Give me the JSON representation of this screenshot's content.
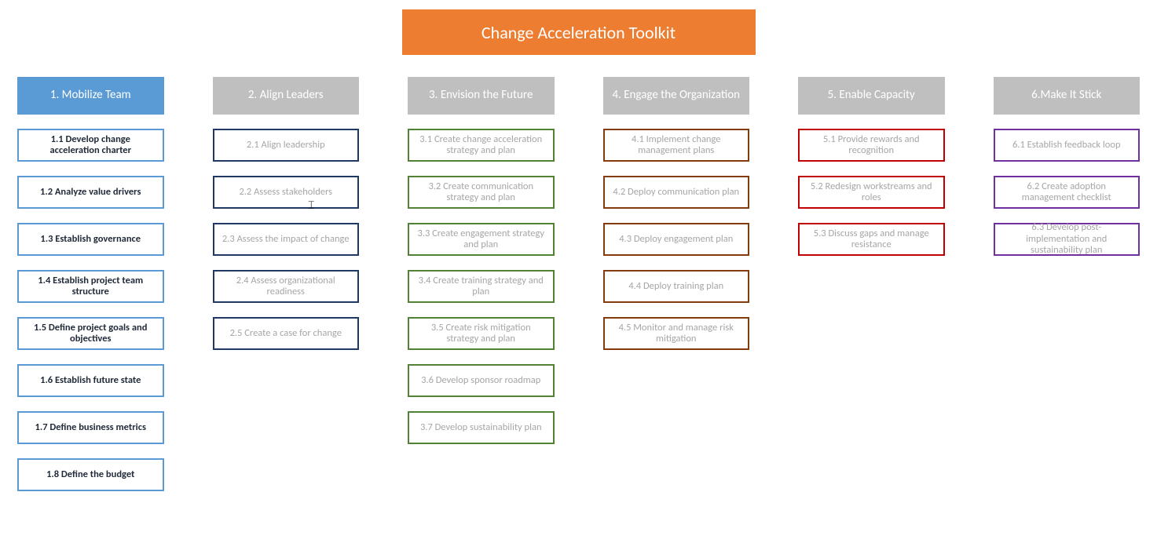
{
  "title": "Change Acceleration Toolkit",
  "columns": [
    {
      "header": "1. Mobilize Team",
      "active": true,
      "colorClass": "c1",
      "items": [
        "1.1 Develop change acceleration charter",
        "1.2 Analyze value drivers",
        "1.3 Establish governance",
        "1.4 Establish project team structure",
        "1.5 Define project goals and objectives",
        "1.6 Establish future state",
        "1.7 Define business metrics",
        "1.8 Define the budget"
      ]
    },
    {
      "header": "2. Align Leaders",
      "active": false,
      "colorClass": "c2",
      "items": [
        "2.1 Align leadership",
        "2.2 Assess stakeholders",
        "2.3 Assess the impact of change",
        "2.4 Assess organizational readiness",
        "2.5 Create a case for change"
      ]
    },
    {
      "header": "3. Envision the Future",
      "active": false,
      "colorClass": "c3",
      "items": [
        "3.1 Create change acceleration strategy and plan",
        "3.2 Create communication strategy and plan",
        "3.3 Create engagement strategy and plan",
        "3.4 Create training strategy and plan",
        "3.5 Create risk mitigation strategy and plan",
        "3.6 Develop sponsor roadmap",
        "3.7 Develop sustainability plan"
      ]
    },
    {
      "header": "4. Engage the Organization",
      "active": false,
      "colorClass": "c4",
      "items": [
        "4.1 Implement change management plans",
        "4.2 Deploy communication plan",
        "4.3 Deploy engagement plan",
        "4.4 Deploy training plan",
        "4.5 Monitor and manage risk mitigation"
      ]
    },
    {
      "header": "5. Enable Capacity",
      "active": false,
      "colorClass": "c5",
      "items": [
        "5.1 Provide rewards and recognition",
        "5.2 Redesign workstreams and roles",
        "5.3 Discuss gaps and manage resistance"
      ]
    },
    {
      "header": "6.Make It Stick",
      "active": false,
      "colorClass": "c6",
      "items": [
        "6.1 Establish feedback loop",
        "6.2 Create adoption management checklist",
        "6.3 Develop post-implementation and sustainability plan"
      ]
    }
  ]
}
